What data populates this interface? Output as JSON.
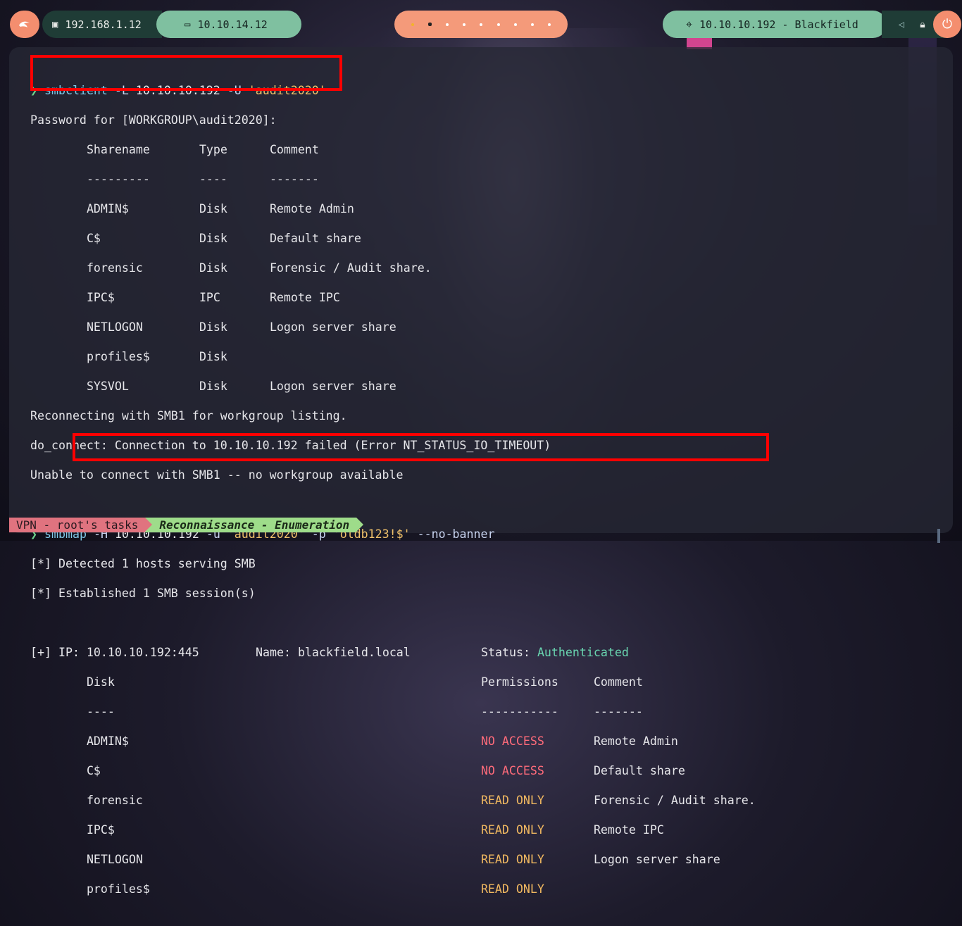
{
  "topbar": {
    "kali_icon": "kali-dragon-icon",
    "local_ip": "192.168.1.12",
    "vpn_ip": "10.10.14.12",
    "workspaces": 9,
    "active_workspace": 2,
    "target": "10.10.10.192 - Blackfield"
  },
  "terminal": {
    "prompt_symbol": "❯",
    "cmd1": {
      "bin": "smbclient",
      "flag1": "-L",
      "host": "10.10.10.192",
      "flag2": "-U",
      "user": "'audit2020'"
    },
    "password_line": "Password for [WORKGROUP\\audit2020]:",
    "smbclient_headers": [
      "Sharename",
      "Type",
      "Comment"
    ],
    "smbclient_seps": [
      "---------",
      "----",
      "-------"
    ],
    "smbclient_rows": [
      [
        "ADMIN$",
        "Disk",
        "Remote Admin"
      ],
      [
        "C$",
        "Disk",
        "Default share"
      ],
      [
        "forensic",
        "Disk",
        "Forensic / Audit share."
      ],
      [
        "IPC$",
        "IPC",
        "Remote IPC"
      ],
      [
        "NETLOGON",
        "Disk",
        "Logon server share"
      ],
      [
        "profiles$",
        "Disk",
        ""
      ],
      [
        "SYSVOL",
        "Disk",
        "Logon server share"
      ]
    ],
    "msg1": "Reconnecting with SMB1 for workgroup listing.",
    "msg2": "do_connect: Connection to 10.10.10.192 failed (Error NT_STATUS_IO_TIMEOUT)",
    "msg3": "Unable to connect with SMB1 -- no workgroup available",
    "cmd2": {
      "bin": "smbmap",
      "flag1": "-H",
      "host": "10.10.10.192",
      "flag2": "-u",
      "user": "'audit2020'",
      "flag3": "-p",
      "pass": "'oldb123!$'",
      "flag4": "--no-banner"
    },
    "smbmap_msg1": "[*] Detected 1 hosts serving SMB",
    "smbmap_msg2": "[*] Established 1 SMB session(s)",
    "ip_label": "[+] IP: 10.10.10.192:445",
    "name_label": "Name: blackfield.local",
    "status_label": "Status:",
    "status_value": "Authenticated",
    "smbmap_headers": [
      "Disk",
      "Permissions",
      "Comment"
    ],
    "smbmap_seps": [
      "----",
      "-----------",
      "-------"
    ],
    "smbmap_rows": [
      [
        "ADMIN$",
        "NO ACCESS",
        "Remote Admin"
      ],
      [
        "C$",
        "NO ACCESS",
        "Default share"
      ],
      [
        "forensic",
        "READ ONLY",
        "Forensic / Audit share."
      ],
      [
        "IPC$",
        "READ ONLY",
        "Remote IPC"
      ],
      [
        "NETLOGON",
        "READ ONLY",
        "Logon server share"
      ],
      [
        "profiles$",
        "READ ONLY",
        ""
      ]
    ]
  },
  "statusbar": {
    "session": "VPN - root's tasks",
    "window": "Reconnaissance - Enumeration"
  }
}
